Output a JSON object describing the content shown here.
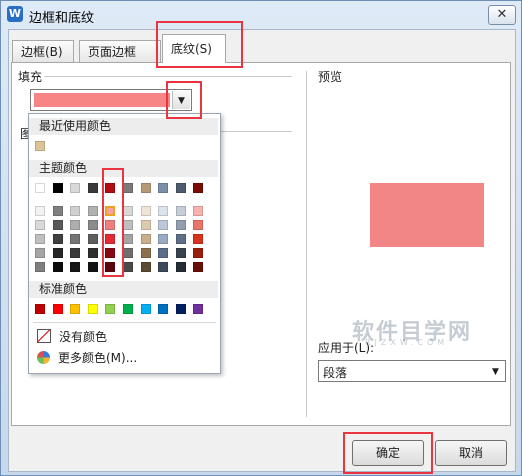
{
  "window": {
    "title": "边框和底纹",
    "app_icon_letter": "W",
    "close_glyph": "✕"
  },
  "tabs": [
    {
      "label": "边框(B)"
    },
    {
      "label": "页面边框(P)"
    },
    {
      "label": "底纹(S)",
      "active": true
    }
  ],
  "fill": {
    "group_label": "填充",
    "selected_color": "#f78585",
    "arrow_glyph": "▼",
    "hidden_label": "图"
  },
  "preview": {
    "label": "预览",
    "color": "#f28585"
  },
  "apply_to": {
    "label": "应用于(L):",
    "value": "段落",
    "arrow_glyph": "▼"
  },
  "popup": {
    "recent_label": "最近使用颜色",
    "recent_colors": [
      "#dcc399"
    ],
    "theme_label": "主题颜色",
    "theme_top": [
      "#ffffff",
      "#000000",
      "#d9d9d9",
      "#3a3a3a",
      "#b40c13",
      "#7a7a7a",
      "#b59a76",
      "#7b8fa8",
      "#4c5b6d",
      "#7a0c06"
    ],
    "theme_shades": [
      [
        "#f2f2f2",
        "#7f7f7f",
        "#d0d0d0",
        "#b1b1b1",
        "#f5a3a3",
        "#d8d8d8",
        "#eee5d6",
        "#dde3ec",
        "#c6cdd8",
        "#f6b2ad"
      ],
      [
        "#d9d9d9",
        "#595959",
        "#aeaeae",
        "#8b8b8b",
        "#ef7f7f",
        "#bfbfbf",
        "#dccaad",
        "#bcc8d9",
        "#929eb0",
        "#ec7368"
      ],
      [
        "#bfbfbf",
        "#3f3f3f",
        "#757575",
        "#5e5e5e",
        "#e32b33",
        "#a5a5a5",
        "#c9b08b",
        "#9aacc5",
        "#5e6e86",
        "#d7321b"
      ],
      [
        "#a5a5a5",
        "#262626",
        "#3a3a3a",
        "#2f2f2f",
        "#880912",
        "#6e6e6e",
        "#8b704e",
        "#5a6e8a",
        "#39434f",
        "#9d1d0c"
      ],
      [
        "#7f7f7f",
        "#0c0c0c",
        "#171717",
        "#131313",
        "#5a060c",
        "#4a4a4a",
        "#5c4a33",
        "#3c4a5c",
        "#262d35",
        "#680f07"
      ]
    ],
    "standard_label": "标准颜色",
    "standard_colors": [
      "#c00000",
      "#ff0000",
      "#ffc000",
      "#ffff00",
      "#92d050",
      "#00b050",
      "#00b0f0",
      "#0070c0",
      "#002060",
      "#7030a0"
    ],
    "no_color_label": "没有颜色",
    "more_colors_label": "更多颜色(M)..."
  },
  "buttons": {
    "ok": "确定",
    "cancel": "取消"
  },
  "watermark": {
    "text": "软件目学网",
    "sub": "RJZXW.COM"
  }
}
